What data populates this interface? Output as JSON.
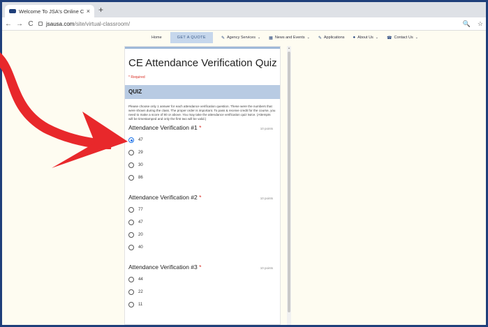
{
  "browser": {
    "tab_title": "Welcome To JSA's Online CE – Vi",
    "tab_close": "×",
    "new_tab": "+",
    "back": "←",
    "forward": "→",
    "reload": "C",
    "url_host": "jsausa.com",
    "url_path": "/site/virtual-classroom/",
    "zoom_icon_glyph": "🔍",
    "star_icon_glyph": "☆"
  },
  "sitenav": {
    "items": [
      {
        "label": "Home",
        "icon": "",
        "caret": false
      },
      {
        "label": "GET A QUOTE",
        "icon": "",
        "caret": false,
        "highlight": true
      },
      {
        "label": "Agency Services",
        "icon": "✎",
        "caret": true
      },
      {
        "label": "News and Events",
        "icon": "▦",
        "caret": true
      },
      {
        "label": "Applications",
        "icon": "✎",
        "caret": false
      },
      {
        "label": "About Us",
        "icon": "●",
        "caret": true
      },
      {
        "label": "Contact Us",
        "icon": "☎",
        "caret": true
      }
    ]
  },
  "quiz": {
    "title": "CE Attendance Verification Quiz",
    "required_note": "* Required",
    "section_title": "QUIZ",
    "description": "Please choose only 1 answer for each attendance verification question. These were the numbers that were shown during the class. The proper order is important. To pass & receive credit for the course, you need to make a score of 80 or above. You may take the attendance verification quiz twice. (Attempts will be timestamped and only the first two will be valid.)",
    "questions": [
      {
        "title": "Attendance Verification #1",
        "points": "10 points",
        "options": [
          "47",
          "29",
          "30",
          "86"
        ],
        "selected": 0
      },
      {
        "title": "Attendance Verification #2",
        "points": "10 points",
        "options": [
          "77",
          "47",
          "20",
          "40"
        ],
        "selected": -1
      },
      {
        "title": "Attendance Verification #3",
        "points": "10 points",
        "options": [
          "44",
          "22",
          "11"
        ],
        "selected": -1
      }
    ]
  },
  "colors": {
    "frame": "#1f3f7a",
    "arrow": "#e8282b",
    "section_bar": "#b8cbe3",
    "radio_selected": "#1a73e8"
  }
}
